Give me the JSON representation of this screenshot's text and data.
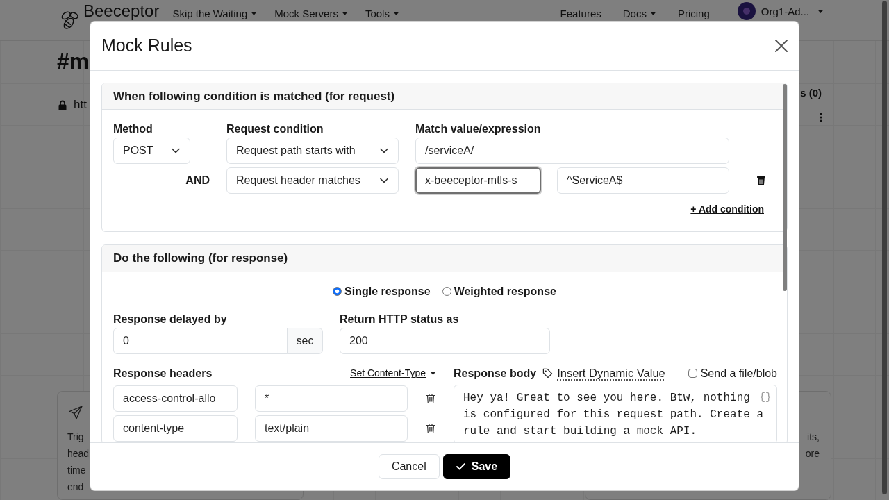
{
  "background_page": {
    "navbar": {
      "logo": "Beeceptor",
      "menu": [
        {
          "label": "Skip the Waiting",
          "dropdown": true
        },
        {
          "label": "Mock Servers",
          "dropdown": true
        },
        {
          "label": "Tools",
          "dropdown": true
        }
      ],
      "right_menu": [
        {
          "label": "Features",
          "dropdown": false
        },
        {
          "label": "Docs",
          "dropdown": true
        },
        {
          "label": "Pricing",
          "dropdown": false
        }
      ],
      "account": {
        "label": "Org1-Ad...",
        "dropdown": true
      }
    },
    "heading": "#m",
    "endpoint": "htt",
    "side_title": "s (0)",
    "cards": [
      {
        "kind": "icon",
        "lines": [
          "Trig",
          "head",
          "time",
          "end"
        ]
      },
      {
        "kind": "text",
        "lines": [
          "its,",
          "ore"
        ]
      }
    ]
  },
  "modal": {
    "title": "Mock Rules",
    "request_section": {
      "title": "When following condition is matched (for request)",
      "columns": [
        "Method",
        "Request condition",
        "Match value/expression"
      ],
      "conditions": [
        {
          "kind": "first",
          "method": "POST",
          "condition": "Request path starts with",
          "value": "/serviceA/",
          "removable": false
        },
        {
          "kind": "header",
          "connector": "AND",
          "condition": "Request header matches",
          "header": "x-beeceptor-mtls-s",
          "header_focused": true,
          "value": "^ServiceA$",
          "removable": true
        }
      ],
      "add_condition": "+ Add condition"
    },
    "response_section": {
      "title": "Do the following (for response)",
      "modes": [
        {
          "label": "Single response",
          "selected": true
        },
        {
          "label": "Weighted response",
          "selected": false
        }
      ],
      "delay": {
        "label": "Response delayed by",
        "value": "0",
        "unit": "sec"
      },
      "status": {
        "label": "Return HTTP status as",
        "value": "200"
      },
      "headers": {
        "label": "Response headers",
        "content_type_menu": "Set Content-Type",
        "rows": [
          {
            "key": "access-control-allo",
            "value": "*"
          },
          {
            "key": "content-type",
            "value": "text/plain"
          }
        ]
      },
      "body": {
        "label": "Response body",
        "insert_dynamic": "Insert Dynamic Value",
        "send_file": {
          "label": "Send a file/blob",
          "checked": false
        },
        "format_icon": "{}",
        "value": "Hey ya! Great to see you here. Btw, nothing is configured for this request path. Create a rule and start building a mock API."
      }
    },
    "buttons": [
      {
        "label": "Cancel",
        "kind": "cancel"
      },
      {
        "label": "Save",
        "kind": "confirm"
      }
    ]
  }
}
